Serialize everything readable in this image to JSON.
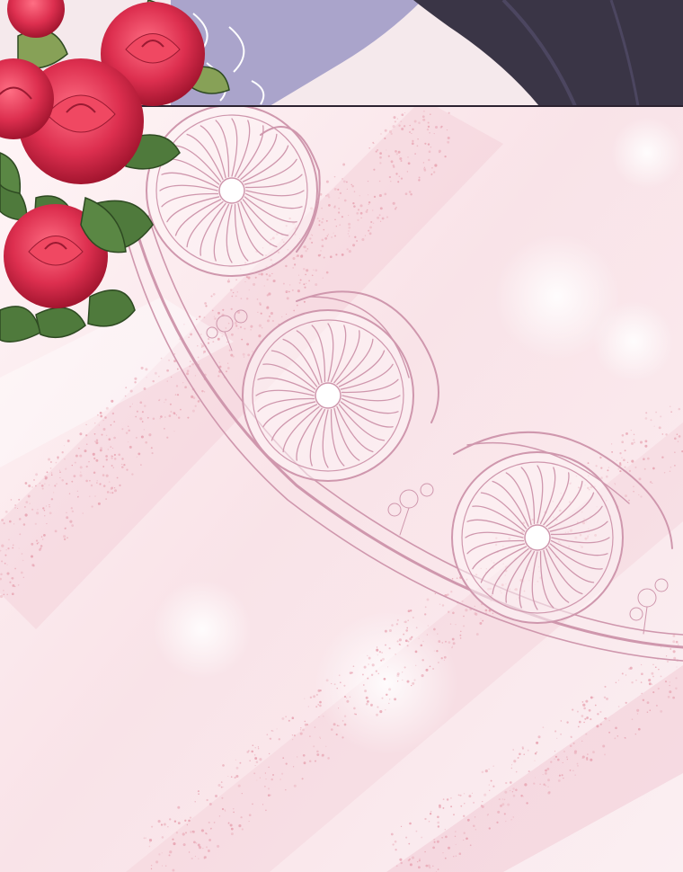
{
  "scene": {
    "panels": [
      "top-panel",
      "main-panel"
    ],
    "colors": {
      "background_pink": "#fbeef1",
      "sparkle_pink": "#e7a2b0",
      "lace_outline": "#cf97ad",
      "rose_red": "#dd2f4f",
      "leaf_green": "#4f7a3c",
      "dark_fabric": "#3a3546",
      "panel_border": "#2b2230",
      "lavender_cloth": "#aaa4cb"
    },
    "icons": [
      "rose-bouquet",
      "tiara-ornament",
      "chrysanthemum-medallion",
      "sparkle-dust"
    ]
  }
}
